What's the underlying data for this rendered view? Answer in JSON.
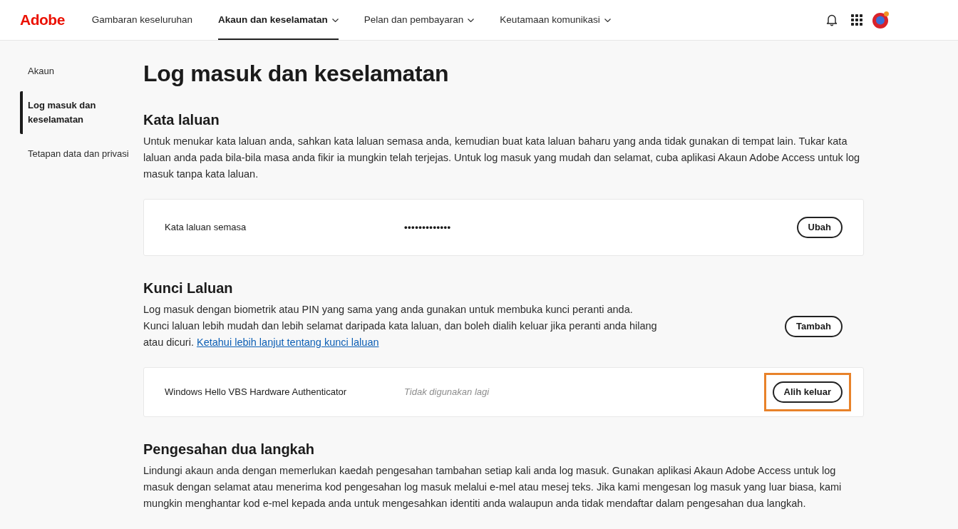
{
  "header": {
    "logo": "Adobe",
    "nav": [
      {
        "label": "Gambaran keseluruhan",
        "selected": false,
        "has_menu": false
      },
      {
        "label": "Akaun dan keselamatan",
        "selected": true,
        "has_menu": true
      },
      {
        "label": "Pelan dan pembayaran",
        "selected": false,
        "has_menu": true
      },
      {
        "label": "Keutamaan komunikasi",
        "selected": false,
        "has_menu": true
      }
    ]
  },
  "sidebar": {
    "items": [
      {
        "label": "Akaun",
        "selected": false
      },
      {
        "label": "Log masuk dan keselamatan",
        "selected": true
      },
      {
        "label": "Tetapan data dan privasi",
        "selected": false
      }
    ]
  },
  "page_title": "Log masuk dan keselamatan",
  "sections": [
    {
      "heading": "Kata laluan",
      "description": "Untuk menukar kata laluan anda, sahkan kata laluan semasa anda, kemudian buat kata laluan baharu yang anda tidak gunakan di tempat lain. Tukar kata laluan anda pada bila-bila masa anda fikir ia mungkin telah terjejas. Untuk log masuk yang mudah dan selamat, cuba aplikasi Akaun Adobe Access untuk log masuk tanpa kata laluan.",
      "rows": [
        {
          "kind": "password",
          "label": "Kata laluan semasa",
          "value": "•••••••••••••",
          "button": {
            "label": "Ubah",
            "highlighted": false
          }
        }
      ]
    },
    {
      "heading": "Kunci Laluan",
      "description": "Log masuk dengan biometrik atau PIN yang sama yang anda gunakan untuk membuka kunci peranti anda. Kunci laluan lebih mudah dan lebih selamat daripada kata laluan, dan boleh dialih keluar jika peranti anda hilang atau dicuri.",
      "link": "Ketahui lebih lanjut tentang kunci laluan",
      "button": {
        "label": "Tambah",
        "highlighted": false
      },
      "rows": [
        {
          "kind": "status",
          "label": "Windows Hello VBS Hardware Authenticator",
          "value": "Tidak digunakan lagi",
          "button": {
            "label": "Alih keluar",
            "highlighted": true
          }
        }
      ]
    },
    {
      "heading": "Pengesahan dua langkah",
      "description": "Lindungi akaun anda dengan memerlukan kaedah pengesahan tambahan setiap kali anda log masuk. Gunakan aplikasi Akaun Adobe Access untuk log masuk dengan selamat atau menerima kod pengesahan log masuk melalui e-mel atau mesej teks. Jika kami mengesan log masuk yang luar biasa, kami mungkin menghantar kod e-mel kepada anda untuk mengesahkan identiti anda walaupun anda tidak mendaftar dalam pengesahan dua langkah."
    }
  ]
}
